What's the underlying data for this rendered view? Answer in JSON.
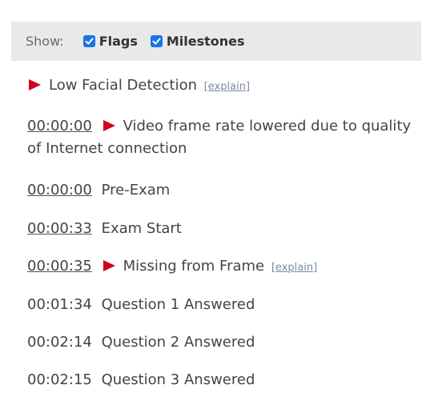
{
  "filter": {
    "label": "Show:",
    "flags_label": "Flags",
    "milestones_label": "Milestones",
    "flags_checked": true,
    "milestones_checked": true
  },
  "events": [
    {
      "time": "",
      "flag": true,
      "text": "Low Facial Detection",
      "explain": "[explain]"
    },
    {
      "time": "00:00:00",
      "time_link": true,
      "flag": true,
      "text": "Video frame rate lowered due to quality of Internet connection"
    },
    {
      "time": "00:00:00",
      "time_link": true,
      "flag": false,
      "text": "Pre-Exam"
    },
    {
      "time": "00:00:33",
      "time_link": true,
      "flag": false,
      "text": "Exam Start"
    },
    {
      "time": "00:00:35",
      "time_link": true,
      "flag": true,
      "text": "Missing from Frame",
      "explain": "[explain]"
    },
    {
      "time": "00:01:34",
      "time_link": false,
      "flag": false,
      "text": "Question 1 Answered"
    },
    {
      "time": "00:02:14",
      "time_link": false,
      "flag": false,
      "text": "Question 2 Answered"
    },
    {
      "time": "00:02:15",
      "time_link": false,
      "flag": false,
      "text": "Question 3 Answered"
    }
  ],
  "colors": {
    "flag": "#d0021b",
    "checkbox": "#1a73e8",
    "filter_bar": "#e9e9e9"
  }
}
